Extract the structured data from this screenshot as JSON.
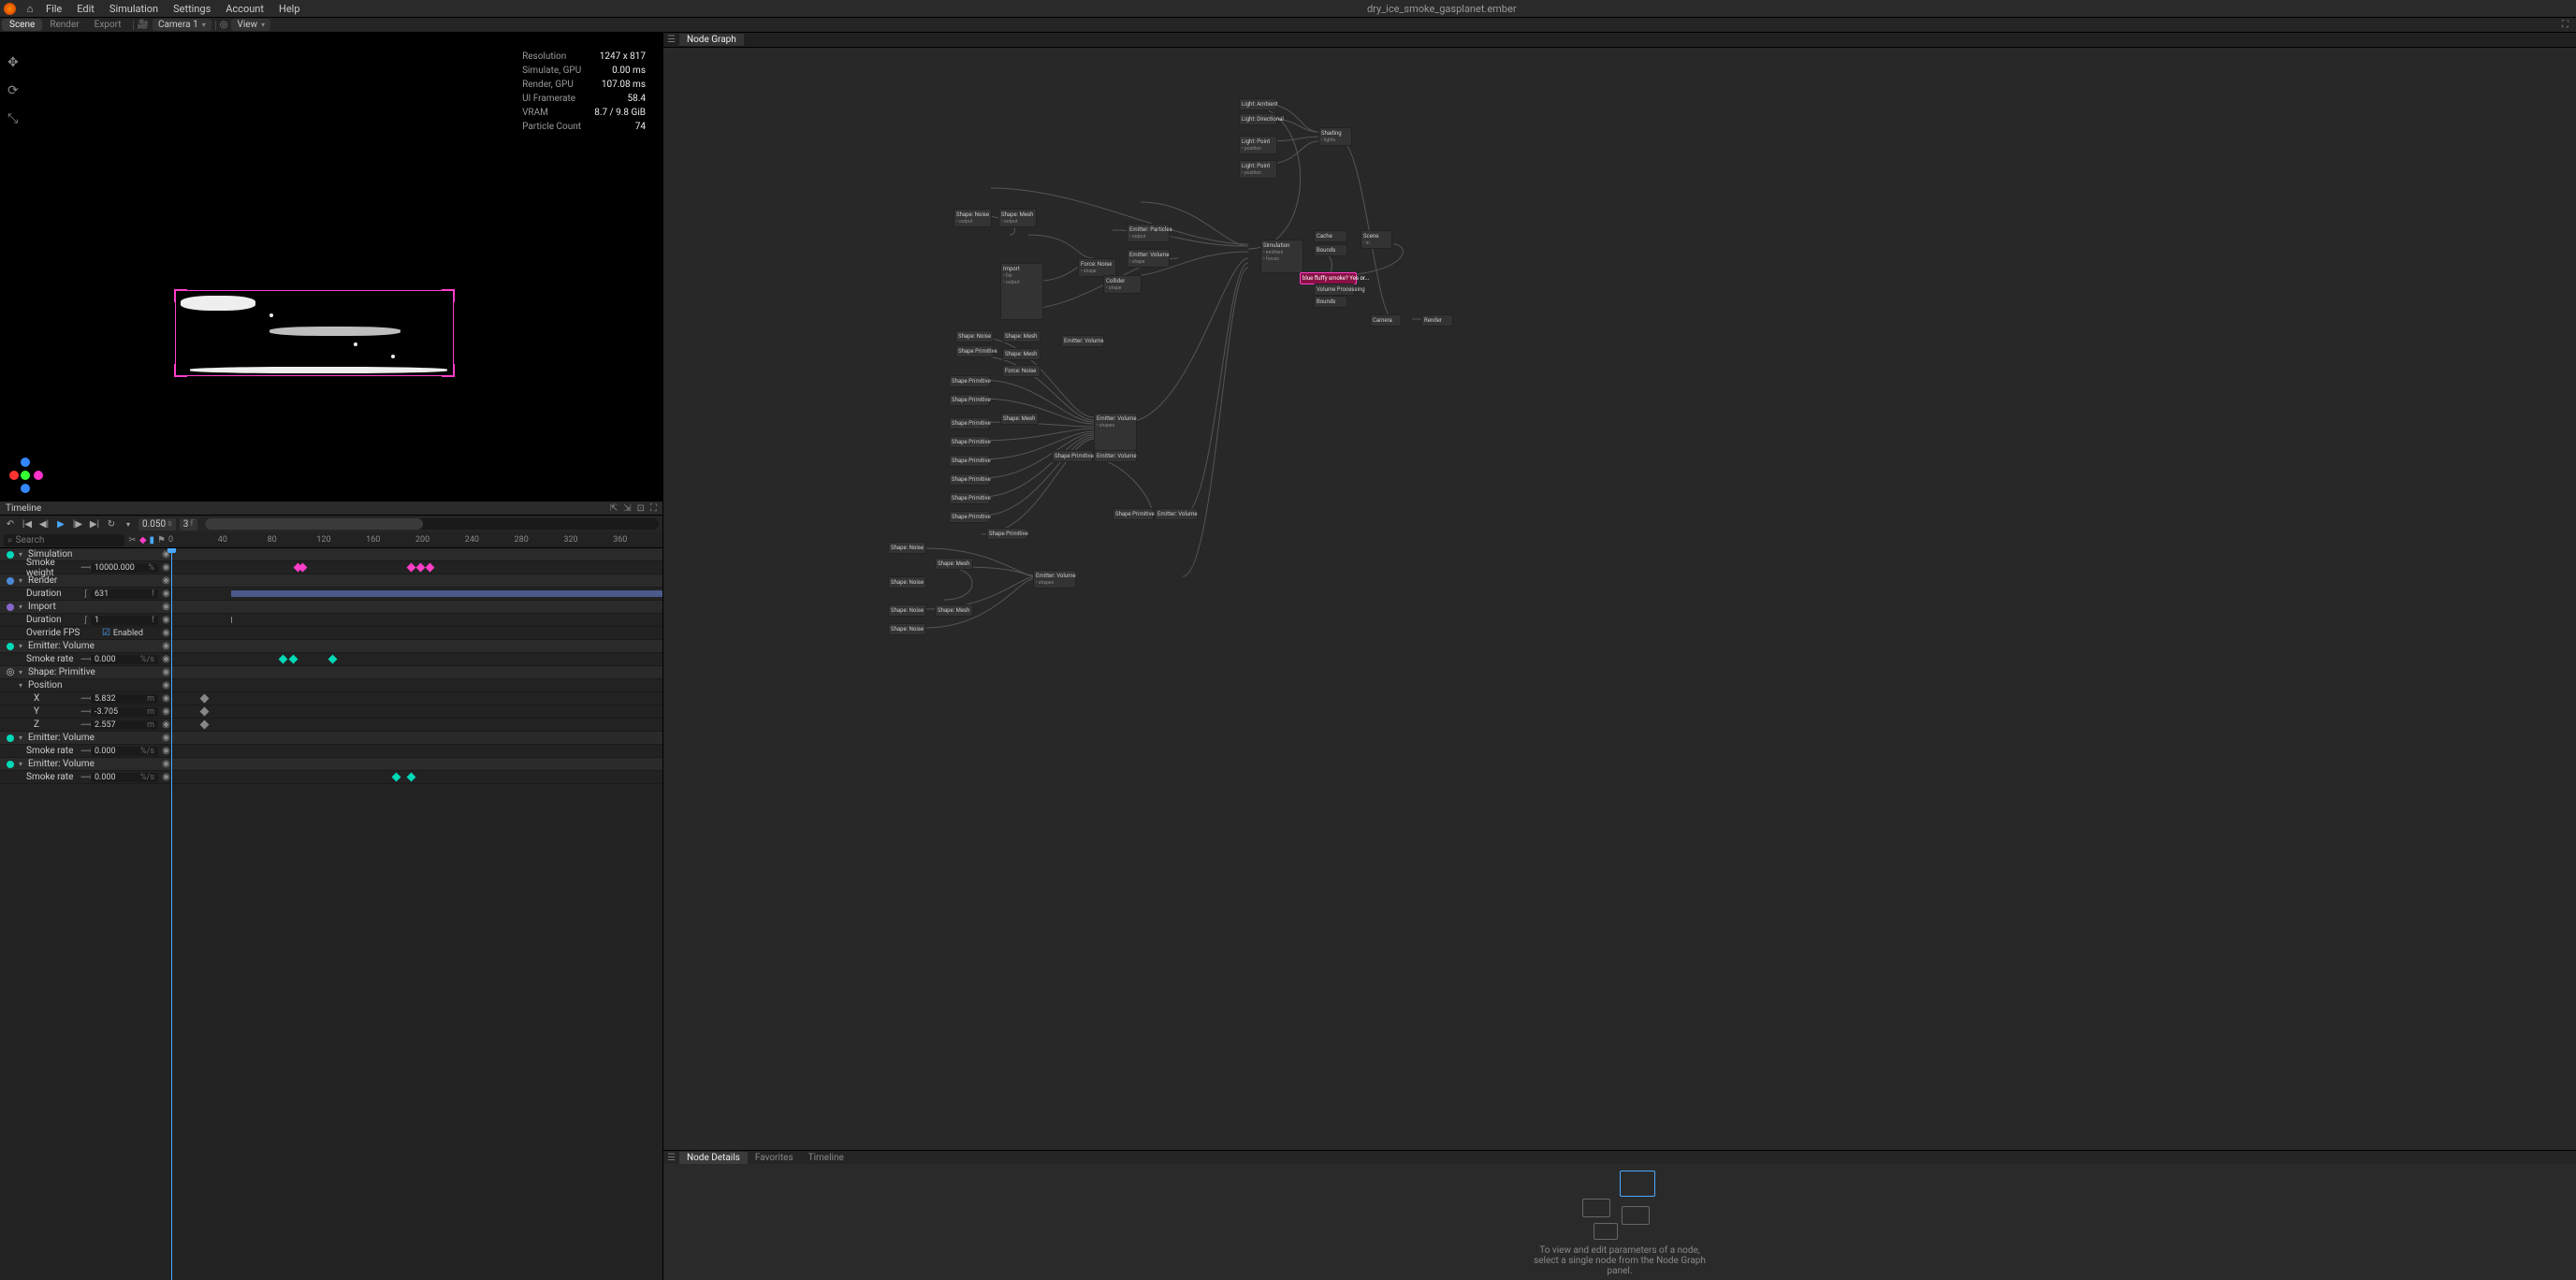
{
  "app": {
    "title": "dry_ice_smoke_gasplanet.ember",
    "menus": [
      "File",
      "Edit",
      "Simulation",
      "Settings",
      "Account",
      "Help"
    ]
  },
  "toolbar": {
    "tabs": [
      "Scene",
      "Render",
      "Export"
    ],
    "active_tab": "Scene",
    "camera": "Camera 1",
    "view": "View"
  },
  "right_panel": {
    "tab": "Node Graph"
  },
  "stats": {
    "resolution_label": "Resolution",
    "resolution": "1247 x 817",
    "simulate_label": "Simulate, GPU",
    "simulate": "0.00 ms",
    "render_label": "Render, GPU",
    "render": "107.08 ms",
    "framerate_label": "UI Framerate",
    "framerate": "58.4",
    "vram_label": "VRAM",
    "vram": "8.7 / 9.8 GiB",
    "particle_label": "Particle Count",
    "particle": "74"
  },
  "timeline": {
    "header": "Timeline",
    "speed": "0.050",
    "speed_unit": "s",
    "frame": "3",
    "frame_unit": "f",
    "search_placeholder": "Search",
    "ticks": [
      "0",
      "40",
      "80",
      "120",
      "160",
      "200",
      "240",
      "280",
      "320",
      "360"
    ]
  },
  "tracks": {
    "simulation": "Simulation",
    "smoke_weight": "Smoke weight",
    "smoke_weight_val": "10000.000",
    "smoke_weight_unit": "%",
    "render": "Render",
    "duration": "Duration",
    "render_duration_val": "631",
    "frame_unit": "f",
    "import": "Import",
    "import_duration_val": "1",
    "override_fps": "Override FPS",
    "enabled": "Enabled",
    "emitter_volume": "Emitter: Volume",
    "smoke_rate": "Smoke rate",
    "smoke_rate_val": "0.000",
    "rate_unit": "%/s",
    "shape_primitive": "Shape: Primitive",
    "position": "Position",
    "x": "X",
    "x_val": "5.832",
    "m": "m",
    "y": "Y",
    "y_val": "-3.705",
    "z": "Z",
    "z_val": "2.557"
  },
  "details": {
    "tabs": [
      "Node Details",
      "Favorites",
      "Timeline"
    ],
    "active": "Node Details",
    "msg": "To view and edit parameters of a node, select a single node from the Node Graph panel."
  },
  "graph_nodes": {
    "selected": "blue fluffy smoke? Yes or..."
  }
}
